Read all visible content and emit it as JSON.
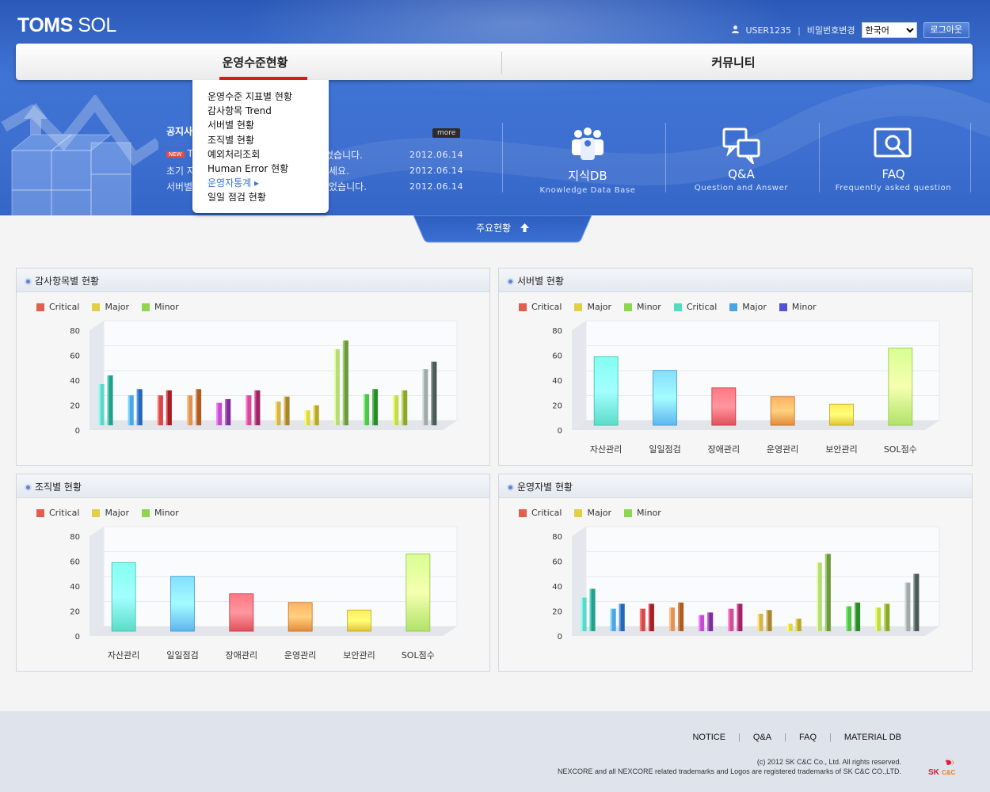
{
  "app": {
    "logo_bold": "TOMS",
    "logo_light": "SOL"
  },
  "util": {
    "user": "USER1235",
    "separator": "|",
    "change_password": "비밀번호변경",
    "language": "한국어",
    "logout": "로그아웃"
  },
  "nav": {
    "tabs": [
      {
        "label": "운영수준현황"
      },
      {
        "label": "커뮤니티"
      }
    ]
  },
  "dropdown": {
    "items": [
      {
        "label": "운영수준 지표별 현황"
      },
      {
        "label": "감사항목 Trend"
      },
      {
        "label": "서버별 현황"
      },
      {
        "label": "조직별 현황"
      },
      {
        "label": "예외처리조회"
      },
      {
        "label": "Human Error 현황"
      },
      {
        "label": "운영자통계 ▸"
      },
      {
        "label": "일일 점검 현황"
      }
    ]
  },
  "notice": {
    "title": "공지사",
    "more": "more",
    "new_badge": "NEW",
    "items": [
      {
        "left": "T",
        "right": "었습니다.",
        "date": "2012.06.14"
      },
      {
        "left": "초기 자",
        "right": "세요.",
        "date": "2012.06.14"
      },
      {
        "left": "서버별",
        "right": "었습니다.",
        "date": "2012.06.14"
      }
    ]
  },
  "quicklinks": [
    {
      "title": "지식DB",
      "subtitle": "Knowledge Data Base",
      "icon": "people-icon"
    },
    {
      "title": "Q&A",
      "subtitle": "Question and Answer",
      "icon": "chat-bubbles-icon"
    },
    {
      "title": "FAQ",
      "subtitle": "Frequently asked question",
      "icon": "magnifier-screen-icon"
    }
  ],
  "toggle": {
    "label": "주요현황"
  },
  "colors": {
    "critical": "#e0604f",
    "major": "#e3cf45",
    "minor": "#8ed64f",
    "critical2": "#58dcbf",
    "major2": "#4aa4e0",
    "minor2": "#5052d8",
    "accent": "#d0201e"
  },
  "legend3": [
    "Critical",
    "Major",
    "Minor"
  ],
  "legend6": [
    "Critical",
    "Major",
    "Minor",
    "Critical",
    "Major",
    "Minor"
  ],
  "panels": [
    {
      "title": "감사항목별 현황"
    },
    {
      "title": "서버별 현황"
    },
    {
      "title": "조직별 현황"
    },
    {
      "title": "운영자별 현황"
    }
  ],
  "chart_data": [
    {
      "type": "bar",
      "title": "감사항목별 현황",
      "ylim": [
        0,
        80
      ],
      "yticks": [
        0,
        20,
        40,
        60,
        80
      ],
      "categories": [
        "",
        "",
        "",
        "",
        "",
        "",
        "",
        "",
        "",
        "",
        "",
        "",
        ""
      ],
      "bars": [
        [
          33,
          40
        ],
        [
          24,
          29
        ],
        [
          24,
          28
        ],
        [
          24,
          29
        ],
        [
          18,
          21
        ],
        [
          24,
          28
        ],
        [
          19,
          23
        ],
        [
          12,
          16
        ],
        [
          61,
          68
        ],
        [
          25,
          29
        ],
        [
          24,
          28
        ],
        [
          45,
          51
        ]
      ],
      "bar_colors": [
        [
          "#5fd6c8",
          "#23a08c"
        ],
        [
          "#4da7e6",
          "#2466b8"
        ],
        [
          "#d94848",
          "#a71f24"
        ],
        [
          "#e39255",
          "#b05b22"
        ],
        [
          "#c14ed0",
          "#7e2c9e"
        ],
        [
          "#d64a98",
          "#a12266"
        ],
        [
          "#d6b54a",
          "#a8862a"
        ],
        [
          "#e0d84a",
          "#b8a82a"
        ],
        [
          "#b8dc7a",
          "#6d9a3c"
        ],
        [
          "#52c44c",
          "#2a8a28"
        ],
        [
          "#c2dc4a",
          "#8ca82a"
        ],
        [
          "#a0aaa8",
          "#4a5a54"
        ]
      ]
    },
    {
      "type": "bar",
      "title": "서버별 현황",
      "ylim": [
        0,
        80
      ],
      "yticks": [
        0,
        20,
        40,
        60,
        80
      ],
      "categories": [
        "자산관리",
        "일일점검",
        "장애관리",
        "운영관리",
        "보안관리",
        "SOL점수"
      ],
      "values": [
        55,
        44,
        30,
        23,
        17,
        62
      ],
      "bar_colors": [
        "#5cdcc8",
        "#5db6ee",
        "#e0505a",
        "#e28a3a",
        "#e0c435",
        "#b0e26a"
      ]
    },
    {
      "type": "bar",
      "title": "조직별 현황",
      "ylim": [
        0,
        80
      ],
      "yticks": [
        0,
        20,
        40,
        60,
        80
      ],
      "categories": [
        "자산관리",
        "일일점검",
        "장애관리",
        "운영관리",
        "보안관리",
        "SOL점수"
      ],
      "values": [
        55,
        44,
        30,
        23,
        17,
        62
      ],
      "bar_colors": [
        "#5cdcc8",
        "#5db6ee",
        "#e0505a",
        "#e28a3a",
        "#e0c435",
        "#b0e26a"
      ]
    },
    {
      "type": "bar",
      "title": "운영자별 현황",
      "ylim": [
        0,
        80
      ],
      "yticks": [
        0,
        20,
        40,
        60,
        80
      ],
      "bars": [
        [
          27,
          34
        ],
        [
          18,
          22
        ],
        [
          18,
          22
        ],
        [
          19,
          23
        ],
        [
          13,
          15
        ],
        [
          18,
          22
        ],
        [
          14,
          17
        ],
        [
          6,
          10
        ],
        [
          55,
          62
        ],
        [
          20,
          23
        ],
        [
          19,
          22
        ],
        [
          39,
          46
        ]
      ],
      "bar_colors": [
        [
          "#5fd6c8",
          "#23a08c"
        ],
        [
          "#4da7e6",
          "#2466b8"
        ],
        [
          "#d94848",
          "#a71f24"
        ],
        [
          "#e39255",
          "#b05b22"
        ],
        [
          "#c14ed0",
          "#7e2c9e"
        ],
        [
          "#d64a98",
          "#a12266"
        ],
        [
          "#d6b54a",
          "#a8862a"
        ],
        [
          "#e0d84a",
          "#b8a82a"
        ],
        [
          "#b8dc7a",
          "#6d9a3c"
        ],
        [
          "#52c44c",
          "#2a8a28"
        ],
        [
          "#c2dc4a",
          "#8ca82a"
        ],
        [
          "#a0aaa8",
          "#4a5a54"
        ]
      ]
    }
  ],
  "footer": {
    "links": [
      "NOTICE",
      "Q&A",
      "FAQ",
      "MATERIAL DB"
    ],
    "copyright": "(c) 2012 SK C&C Co., Ltd. All rights reserved.",
    "trademark": "NEXCORE and all NEXCORE related trademarks and Logos are registered trademarks of SK C&C CO.,LTD.",
    "brand": "SK C&C"
  }
}
